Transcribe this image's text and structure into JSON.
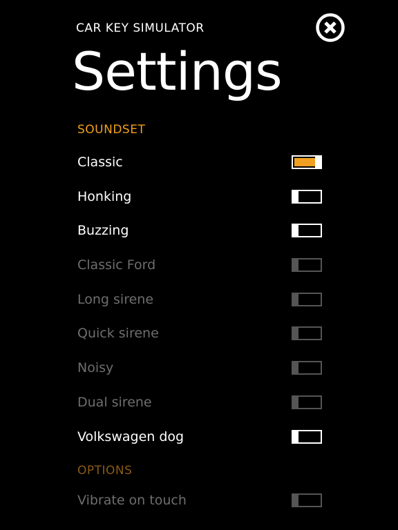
{
  "app": {
    "subtitle": "CAR KEY SIMULATOR",
    "title": "Settings"
  },
  "colors": {
    "accent": "#f0a020",
    "accent_dim": "#8a5a18",
    "enabled_text": "#ffffff",
    "disabled_text": "#6e6e6e"
  },
  "icons": {
    "close": "close-circle-icon"
  },
  "soundset": {
    "header": "SOUNDSET",
    "items": [
      {
        "label": "Classic",
        "checked": true,
        "enabled": true
      },
      {
        "label": "Honking",
        "checked": false,
        "enabled": true
      },
      {
        "label": "Buzzing",
        "checked": false,
        "enabled": true
      },
      {
        "label": "Classic Ford",
        "checked": false,
        "enabled": false
      },
      {
        "label": "Long sirene",
        "checked": false,
        "enabled": false
      },
      {
        "label": "Quick sirene",
        "checked": false,
        "enabled": false
      },
      {
        "label": "Noisy",
        "checked": false,
        "enabled": false
      },
      {
        "label": "Dual sirene",
        "checked": false,
        "enabled": false
      },
      {
        "label": "Volkswagen dog",
        "checked": false,
        "enabled": true
      }
    ]
  },
  "options": {
    "header": "OPTIONS",
    "items": [
      {
        "label": "Vibrate on touch",
        "checked": false,
        "enabled": false
      }
    ]
  }
}
